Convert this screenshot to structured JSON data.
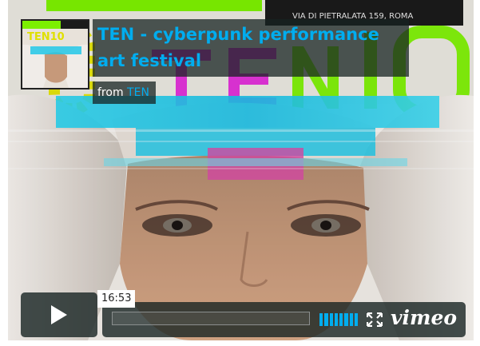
{
  "video": {
    "title": "TEN - cyberpunk performance art festival",
    "from_label": "from",
    "author": "TEN",
    "duration": "16:53",
    "progress_fraction": 0.0,
    "volume_level": 1.0
  },
  "poster": {
    "venue_text": "VIA DI PIETRALATA 159, ROMA",
    "logo_text": "TEN10"
  },
  "brand": {
    "logo": "vimeo"
  },
  "icons": {
    "play": "play-icon",
    "volume": "volume-icon",
    "fullscreen": "fullscreen-icon"
  },
  "colors": {
    "accent": "#00adef",
    "overlay": "#172322",
    "poster_green": "#7cf000",
    "poster_magenta": "#e02ad8",
    "poster_cyan": "#22c8e8"
  }
}
